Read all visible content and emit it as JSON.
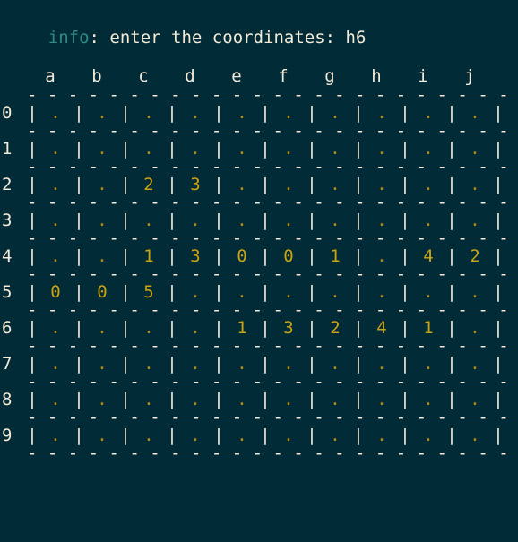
{
  "status": {
    "tag": "info",
    "separator": ": ",
    "message": "enter the coordinates: ",
    "input_value": "h6",
    "full_text": "info: enter the coordinates: h6"
  },
  "colors": {
    "background": "#012b36",
    "foreground": "#f3ead8",
    "info_tag": "#2e8b85",
    "cell_number": "#c8a415",
    "cell_empty_dot": "#b08c12"
  },
  "board": {
    "column_headers": [
      "a",
      "b",
      "c",
      "d",
      "e",
      "f",
      "g",
      "h",
      "i",
      "j"
    ],
    "row_labels": [
      "0",
      "1",
      "2",
      "3",
      "4",
      "5",
      "6",
      "7",
      "8",
      "9"
    ],
    "empty_symbol": ".",
    "vertical_divider": "|",
    "horizontal_divider": "- - - - - - - - - - - - - - - - - - - - - - - - - - -",
    "rows": [
      {
        "label": "0",
        "cells": [
          ".",
          ".",
          ".",
          ".",
          ".",
          ".",
          ".",
          ".",
          ".",
          "."
        ]
      },
      {
        "label": "1",
        "cells": [
          ".",
          ".",
          ".",
          ".",
          ".",
          ".",
          ".",
          ".",
          ".",
          "."
        ]
      },
      {
        "label": "2",
        "cells": [
          ".",
          ".",
          "2",
          "3",
          ".",
          ".",
          ".",
          ".",
          ".",
          "."
        ]
      },
      {
        "label": "3",
        "cells": [
          ".",
          ".",
          ".",
          ".",
          ".",
          ".",
          ".",
          ".",
          ".",
          "."
        ]
      },
      {
        "label": "4",
        "cells": [
          ".",
          ".",
          "1",
          "3",
          "0",
          "0",
          "1",
          ".",
          "4",
          "2"
        ]
      },
      {
        "label": "5",
        "cells": [
          "0",
          "0",
          "5",
          ".",
          ".",
          ".",
          ".",
          ".",
          ".",
          "."
        ]
      },
      {
        "label": "6",
        "cells": [
          ".",
          ".",
          ".",
          ".",
          "1",
          "3",
          "2",
          "4",
          "1",
          "."
        ]
      },
      {
        "label": "7",
        "cells": [
          ".",
          ".",
          ".",
          ".",
          ".",
          ".",
          ".",
          ".",
          ".",
          "."
        ]
      },
      {
        "label": "8",
        "cells": [
          ".",
          ".",
          ".",
          ".",
          ".",
          ".",
          ".",
          ".",
          ".",
          "."
        ]
      },
      {
        "label": "9",
        "cells": [
          ".",
          ".",
          ".",
          ".",
          ".",
          ".",
          ".",
          ".",
          ".",
          "."
        ]
      }
    ]
  }
}
